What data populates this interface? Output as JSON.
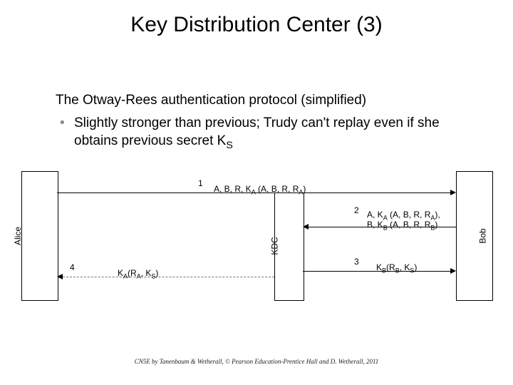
{
  "title": "Key Distribution Center (3)",
  "intro": "The Otway-Rees authentication protocol (simplified)",
  "bullet": {
    "dot": "•",
    "text_a": "Slightly stronger than previous; Trudy can't replay even if she obtains previous secret K",
    "text_sub": "S"
  },
  "parties": {
    "alice": "Alice",
    "kdc": "KDC",
    "bob": "Bob"
  },
  "msgs": {
    "n1": "1",
    "m1": "A, B, R, K",
    "m1s": "A",
    "m1b": " (A, B, R, R",
    "m1bs": "A",
    "m1c": ")",
    "n2": "2",
    "m2a": "A, K",
    "m2as": "A",
    "m2b": " (A, B, R, R",
    "m2bs": "A",
    "m2c": "),",
    "m2d": "B, K",
    "m2ds": "B",
    "m2e": " (A, B, R, R",
    "m2es": "B",
    "m2f": ")",
    "n3": "3",
    "m3a": "K",
    "m3as": "B",
    "m3b": "(R",
    "m3bs": "B",
    "m3c": ", K",
    "m3cs": "S",
    "m3d": ")",
    "n4": "4",
    "m4a": "K",
    "m4as": "A",
    "m4b": "(R",
    "m4bs": "A",
    "m4c": ", K",
    "m4cs": "S",
    "m4d": ")"
  },
  "footer": "CN5E by Tanenbaum & Wetherall, © Pearson Education-Prentice Hall and D. Wetherall, 2011"
}
